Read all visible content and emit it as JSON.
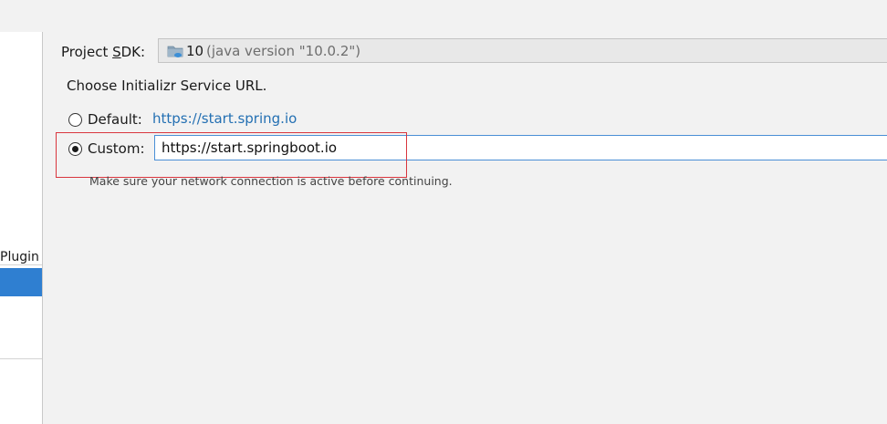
{
  "sidebar": {
    "items": [
      {
        "label": "Plugin"
      }
    ]
  },
  "sdk": {
    "label_prefix": "Project ",
    "label_mnemonic": "S",
    "label_suffix": "DK:",
    "version": "10",
    "detail": "(java version \"10.0.2\")",
    "icon": "folder-icon"
  },
  "initializr": {
    "choose_label": "Choose Initializr Service URL.",
    "default_label": "Default:",
    "default_url": "https://start.spring.io",
    "custom_label": "Custom:",
    "custom_url": "https://start.springboot.io",
    "selected": "custom",
    "hint": "Make sure your network connection is active before continuing."
  },
  "colors": {
    "link": "#2470b3",
    "selection": "#2f7fd1",
    "highlight": "#d9363e",
    "focus_border": "#4a8fd6"
  }
}
